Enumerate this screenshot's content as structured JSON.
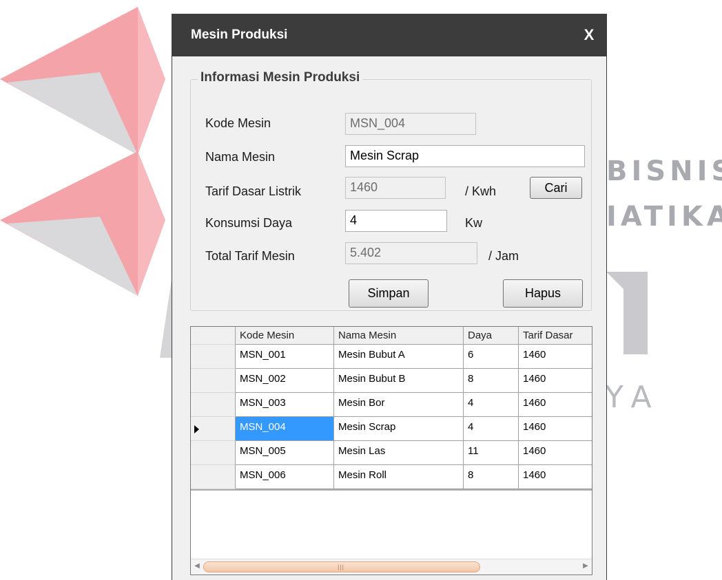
{
  "watermark": {
    "line1": "BISNIS",
    "line2": "IATIKA",
    "line3": "YA"
  },
  "window": {
    "title": "Mesin Produksi",
    "close_label": "X"
  },
  "groupbox": {
    "title": "Informasi Mesin Produksi",
    "kode_mesin": {
      "label": "Kode Mesin",
      "value": "MSN_004"
    },
    "nama_mesin": {
      "label": "Nama Mesin",
      "value": "Mesin Scrap"
    },
    "tarif_dasar": {
      "label": "Tarif Dasar Listrik",
      "value": "1460",
      "unit": "/ Kwh"
    },
    "konsumsi_daya": {
      "label": "Konsumsi Daya",
      "value": "4",
      "unit": "Kw"
    },
    "total_tarif": {
      "label": "Total Tarif Mesin",
      "value": "5.402",
      "unit": "/ Jam"
    },
    "cari_label": "Cari",
    "simpan_label": "Simpan",
    "hapus_label": "Hapus"
  },
  "grid": {
    "columns": [
      "Kode Mesin",
      "Nama Mesin",
      "Daya",
      "Tarif Dasar"
    ],
    "rows": [
      [
        "MSN_001",
        "Mesin Bubut A",
        "6",
        "1460"
      ],
      [
        "MSN_002",
        "Mesin Bubut B",
        "8",
        "1460"
      ],
      [
        "MSN_003",
        "Mesin Bor",
        "4",
        "1460"
      ],
      [
        "MSN_004",
        "Mesin Scrap",
        "4",
        "1460"
      ],
      [
        "MSN_005",
        "Mesin Las",
        "11",
        "1460"
      ],
      [
        "MSN_006",
        "Mesin Roll",
        "8",
        "1460"
      ]
    ],
    "selected_row": 3
  },
  "colors": {
    "titlebar": "#3c3c3c",
    "selection": "#3399ff",
    "scroll_thumb": "#f2c7a8"
  }
}
